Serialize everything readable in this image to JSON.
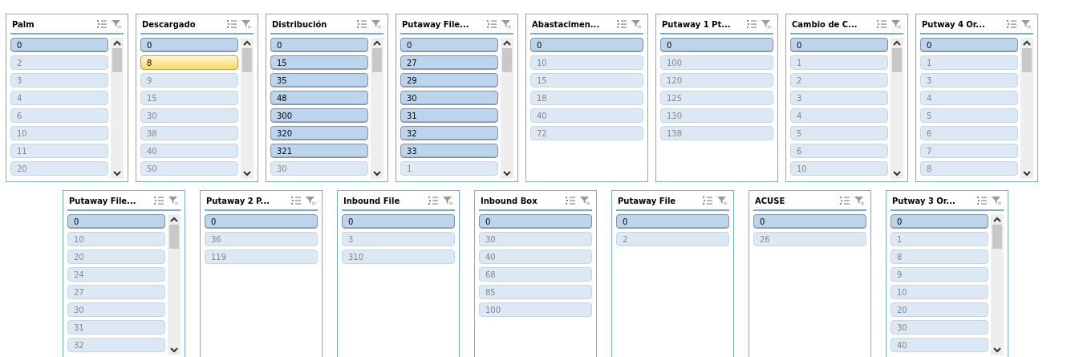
{
  "rows": [
    {
      "listboxes": [
        {
          "title": "Palm",
          "scrollbar": true,
          "items": [
            {
              "label": "0",
              "selected": true
            },
            {
              "label": "2",
              "selected": false
            },
            {
              "label": "3",
              "selected": false
            },
            {
              "label": "4",
              "selected": false
            },
            {
              "label": "6",
              "selected": false
            },
            {
              "label": "10",
              "selected": false
            },
            {
              "label": "11",
              "selected": false
            },
            {
              "label": "20",
              "selected": false
            }
          ]
        },
        {
          "title": "Descargado",
          "scrollbar": true,
          "items": [
            {
              "label": "0",
              "selected": true,
              "highlighted": false
            },
            {
              "label": "8",
              "selected": false,
              "highlighted": true
            },
            {
              "label": "9",
              "selected": false,
              "highlighted": false
            },
            {
              "label": "15",
              "selected": false,
              "highlighted": false
            },
            {
              "label": "30",
              "selected": false,
              "highlighted": false
            },
            {
              "label": "38",
              "selected": false,
              "highlighted": false
            },
            {
              "label": "40",
              "selected": false,
              "highlighted": false
            },
            {
              "label": "50",
              "selected": false,
              "highlighted": false
            }
          ]
        },
        {
          "title": "Distribución",
          "scrollbar": true,
          "items": [
            {
              "label": "0",
              "selected": true
            },
            {
              "label": "15",
              "selected": true
            },
            {
              "label": "35",
              "selected": true
            },
            {
              "label": "48",
              "selected": true
            },
            {
              "label": "300",
              "selected": true
            },
            {
              "label": "320",
              "selected": true
            },
            {
              "label": "321",
              "selected": true
            },
            {
              "label": "30",
              "selected": false
            }
          ]
        },
        {
          "title": "Putaway File...",
          "scrollbar": true,
          "items": [
            {
              "label": "0",
              "selected": true
            },
            {
              "label": "27",
              "selected": true
            },
            {
              "label": "29",
              "selected": true
            },
            {
              "label": "30",
              "selected": true
            },
            {
              "label": "31",
              "selected": true
            },
            {
              "label": "32",
              "selected": true
            },
            {
              "label": "33",
              "selected": true
            },
            {
              "label": "1",
              "selected": false
            }
          ]
        },
        {
          "title": "Abastacimen...",
          "scrollbar": false,
          "items": [
            {
              "label": "0",
              "selected": true
            },
            {
              "label": "10",
              "selected": false
            },
            {
              "label": "15",
              "selected": false
            },
            {
              "label": "18",
              "selected": false
            },
            {
              "label": "40",
              "selected": false
            },
            {
              "label": "72",
              "selected": false
            }
          ]
        },
        {
          "title": "Putaway 1 Pt...",
          "scrollbar": false,
          "items": [
            {
              "label": "0",
              "selected": true
            },
            {
              "label": "100",
              "selected": false
            },
            {
              "label": "120",
              "selected": false
            },
            {
              "label": "125",
              "selected": false
            },
            {
              "label": "130",
              "selected": false
            },
            {
              "label": "138",
              "selected": false
            }
          ]
        },
        {
          "title": "Cambio de C...",
          "scrollbar": true,
          "items": [
            {
              "label": "0",
              "selected": true
            },
            {
              "label": "1",
              "selected": false
            },
            {
              "label": "2",
              "selected": false
            },
            {
              "label": "3",
              "selected": false
            },
            {
              "label": "4",
              "selected": false
            },
            {
              "label": "5",
              "selected": false
            },
            {
              "label": "6",
              "selected": false
            },
            {
              "label": "10",
              "selected": false
            }
          ]
        },
        {
          "title": "Putway 4 Or...",
          "scrollbar": true,
          "items": [
            {
              "label": "0",
              "selected": true
            },
            {
              "label": "1",
              "selected": false
            },
            {
              "label": "3",
              "selected": false
            },
            {
              "label": "4",
              "selected": false
            },
            {
              "label": "5",
              "selected": false
            },
            {
              "label": "6",
              "selected": false
            },
            {
              "label": "7",
              "selected": false
            },
            {
              "label": "8",
              "selected": false
            }
          ]
        }
      ]
    },
    {
      "listboxes": [
        {
          "title": "Putaway File...",
          "scrollbar": true,
          "items": [
            {
              "label": "0",
              "selected": true
            },
            {
              "label": "10",
              "selected": false
            },
            {
              "label": "20",
              "selected": false
            },
            {
              "label": "24",
              "selected": false
            },
            {
              "label": "27",
              "selected": false
            },
            {
              "label": "30",
              "selected": false
            },
            {
              "label": "31",
              "selected": false
            },
            {
              "label": "32",
              "selected": false
            }
          ]
        },
        {
          "title": "Putaway 2 P...",
          "scrollbar": false,
          "items": [
            {
              "label": "0",
              "selected": true
            },
            {
              "label": "36",
              "selected": false
            },
            {
              "label": "119",
              "selected": false
            }
          ]
        },
        {
          "title": "Inbound File",
          "scrollbar": false,
          "items": [
            {
              "label": "0",
              "selected": true
            },
            {
              "label": "3",
              "selected": false
            },
            {
              "label": "310",
              "selected": false
            }
          ]
        },
        {
          "title": "Inbound Box",
          "scrollbar": false,
          "items": [
            {
              "label": "0",
              "selected": true
            },
            {
              "label": "30",
              "selected": false
            },
            {
              "label": "40",
              "selected": false
            },
            {
              "label": "68",
              "selected": false
            },
            {
              "label": "85",
              "selected": false
            },
            {
              "label": "100",
              "selected": false
            }
          ]
        },
        {
          "title": "Putaway File",
          "scrollbar": false,
          "items": [
            {
              "label": "0",
              "selected": true
            },
            {
              "label": "2",
              "selected": false
            }
          ]
        },
        {
          "title": "ACUSE",
          "scrollbar": false,
          "items": [
            {
              "label": "0",
              "selected": true
            },
            {
              "label": "26",
              "selected": false
            }
          ]
        },
        {
          "title": "Putway 3 Or...",
          "scrollbar": true,
          "items": [
            {
              "label": "0",
              "selected": true
            },
            {
              "label": "1",
              "selected": false
            },
            {
              "label": "8",
              "selected": false
            },
            {
              "label": "9",
              "selected": false
            },
            {
              "label": "10",
              "selected": false
            },
            {
              "label": "20",
              "selected": false
            },
            {
              "label": "30",
              "selected": false
            },
            {
              "label": "40",
              "selected": false
            }
          ]
        }
      ]
    }
  ]
}
